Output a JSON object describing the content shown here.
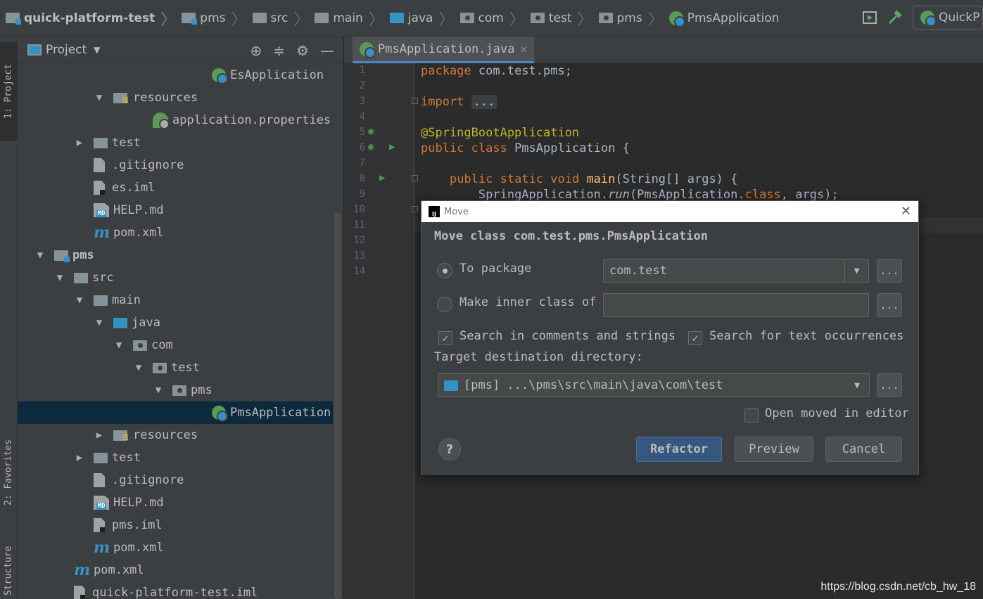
{
  "breadcrumb": [
    "quick-platform-test",
    "pms",
    "src",
    "main",
    "java",
    "com",
    "test",
    "pms",
    "PmsApplication"
  ],
  "run_config": "QuickP",
  "left_strip": {
    "project_tab": "1: Project",
    "favorites_tab": "2: Favorites",
    "structure_tab": "Structure"
  },
  "project_panel": {
    "title": "Project",
    "tree": [
      {
        "label": "EsApplication",
        "icon": "spring-icon",
        "indent": 9,
        "arrow": ""
      },
      {
        "label": "resources",
        "icon": "resources-folder-icon",
        "indent": 4,
        "arrow": "▼"
      },
      {
        "label": "application.properties",
        "icon": "properties-icon",
        "indent": 6,
        "arrow": ""
      },
      {
        "label": "test",
        "icon": "folder-icon",
        "indent": 3,
        "arrow": "▶"
      },
      {
        "label": ".gitignore",
        "icon": "file-icon",
        "indent": 3,
        "arrow": ""
      },
      {
        "label": "es.iml",
        "icon": "iml-icon",
        "indent": 3,
        "arrow": ""
      },
      {
        "label": "HELP.md",
        "icon": "md-icon",
        "indent": 3,
        "arrow": ""
      },
      {
        "label": "pom.xml",
        "icon": "maven-icon",
        "indent": 3,
        "arrow": ""
      },
      {
        "label": "pms",
        "icon": "module-icon",
        "indent": 1,
        "arrow": "▼"
      },
      {
        "label": "src",
        "icon": "folder-icon",
        "indent": 2,
        "arrow": "▼"
      },
      {
        "label": "main",
        "icon": "folder-icon",
        "indent": 3,
        "arrow": "▼"
      },
      {
        "label": "java",
        "icon": "source-folder-icon",
        "indent": 4,
        "arrow": "▼"
      },
      {
        "label": "com",
        "icon": "package-icon",
        "indent": 5,
        "arrow": "▼"
      },
      {
        "label": "test",
        "icon": "package-icon",
        "indent": 6,
        "arrow": "▼"
      },
      {
        "label": "pms",
        "icon": "package-icon",
        "indent": 7,
        "arrow": "▼"
      },
      {
        "label": "PmsApplication",
        "icon": "spring-icon",
        "indent": 9,
        "arrow": "",
        "selected": true
      },
      {
        "label": "resources",
        "icon": "resources-folder-icon",
        "indent": 4,
        "arrow": "▶"
      },
      {
        "label": "test",
        "icon": "folder-icon",
        "indent": 3,
        "arrow": "▶"
      },
      {
        "label": ".gitignore",
        "icon": "file-icon",
        "indent": 3,
        "arrow": ""
      },
      {
        "label": "HELP.md",
        "icon": "md-icon",
        "indent": 3,
        "arrow": ""
      },
      {
        "label": "pms.iml",
        "icon": "iml-icon",
        "indent": 3,
        "arrow": ""
      },
      {
        "label": "pom.xml",
        "icon": "maven-icon",
        "indent": 3,
        "arrow": ""
      },
      {
        "label": "pom.xml",
        "icon": "maven-icon",
        "indent": 2,
        "arrow": ""
      },
      {
        "label": "quick-platform-test.iml",
        "icon": "iml-icon",
        "indent": 2,
        "arrow": ""
      }
    ]
  },
  "editor": {
    "tab_label": "PmsApplication.java",
    "line_numbers": [
      "1",
      "2",
      "3",
      "4",
      "5",
      "6",
      "7",
      "8",
      "9",
      "10",
      "11",
      "12",
      "13",
      "14"
    ],
    "code": {
      "l1_kw": "package",
      "l1_rest": " com.test.pms;",
      "l3_kw": "import",
      "l3_fold": "...",
      "l6_ann": "@SpringBootApplication",
      "l7_kw": "public class",
      "l7_rest": " PmsApplication {",
      "l9_kw": "public static void",
      "l9_fn": "main",
      "l9_rest": "(String[] args) {",
      "l10_a": "SpringApplication.",
      "l10_run": "run",
      "l10_b": "(PmsApplication.",
      "l10_cls": "class",
      "l10_c": ", args);"
    }
  },
  "dialog": {
    "title": "Move",
    "heading": "Move class com.test.pms.PmsApplication",
    "to_package_label": "To package",
    "to_package_value": "com.test",
    "inner_class_label": "Make inner class of",
    "inner_class_value": "",
    "search_comments_label": "Search in comments and strings",
    "search_text_label": "Search for text occurrences",
    "target_dir_label": "Target destination directory:",
    "target_dir_value": "[pms] ...\\pms\\src\\main\\java\\com\\test",
    "open_in_editor_label": "Open moved in editor",
    "dots": "...",
    "refactor": "Refactor",
    "preview": "Preview",
    "cancel": "Cancel",
    "help": "?"
  },
  "watermark": "https://blog.csdn.net/cb_hw_18"
}
